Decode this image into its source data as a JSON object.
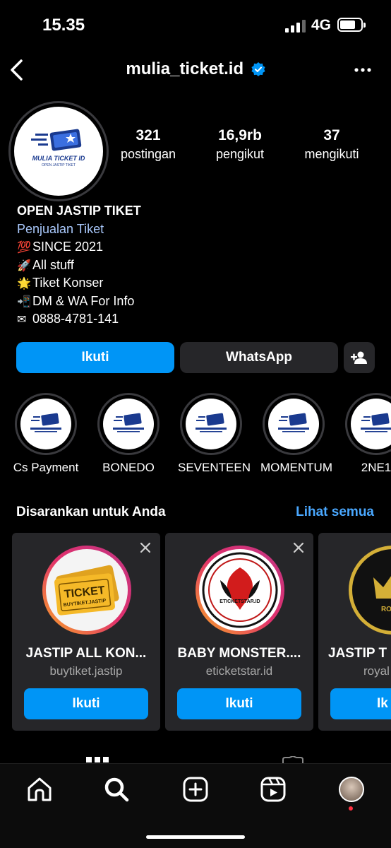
{
  "status": {
    "time": "15.35",
    "network": "4G"
  },
  "header": {
    "username": "mulia_ticket.id"
  },
  "profile": {
    "logo_text": "MULIA TICKET ID",
    "logo_sub": "OPEN JASTIP TIKET",
    "stats": [
      {
        "value": "321",
        "label": "postingan"
      },
      {
        "value": "16,9rb",
        "label": "pengikut"
      },
      {
        "value": "37",
        "label": "mengikuti"
      }
    ],
    "bio": {
      "name": "OPEN JASTIP TIKET",
      "category": "Penjualan Tiket",
      "lines": [
        {
          "emoji": "💯",
          "text": "SINCE 2021"
        },
        {
          "emoji": "🚀",
          "text": "All stuff"
        },
        {
          "emoji": "🌟",
          "text": "Tiket Konser"
        },
        {
          "emoji": "📲",
          "text": "DM & WA For Info"
        },
        {
          "emoji": "✉",
          "text": "0888-4781-141"
        }
      ]
    }
  },
  "actions": {
    "follow": "Ikuti",
    "whatsapp": "WhatsApp"
  },
  "highlights": [
    {
      "label": "Cs Payment"
    },
    {
      "label": "BONEDO"
    },
    {
      "label": "SEVENTEEN"
    },
    {
      "label": "MOMENTUM"
    },
    {
      "label": "2NE1"
    }
  ],
  "suggestions": {
    "heading": "Disarankan untuk Anda",
    "see_all": "Lihat semua",
    "cards": [
      {
        "name": "JASTIP ALL KON...",
        "username": "buytiket.jastip",
        "button": "Ikuti",
        "pic_text": "TICKET",
        "pic_sub": "BUYTIKET.JASTIP"
      },
      {
        "name": "BABY MONSTER....",
        "username": "eticketstar.id",
        "button": "Ikuti",
        "pic_text": "ETICKETSTAR.ID"
      },
      {
        "name": "JASTIP T",
        "username": "royal",
        "button": "Ik",
        "pic_text": "ROYAL"
      }
    ]
  },
  "colors": {
    "accent": "#0095f6",
    "link": "#4aa8ff",
    "surface": "#262629"
  }
}
